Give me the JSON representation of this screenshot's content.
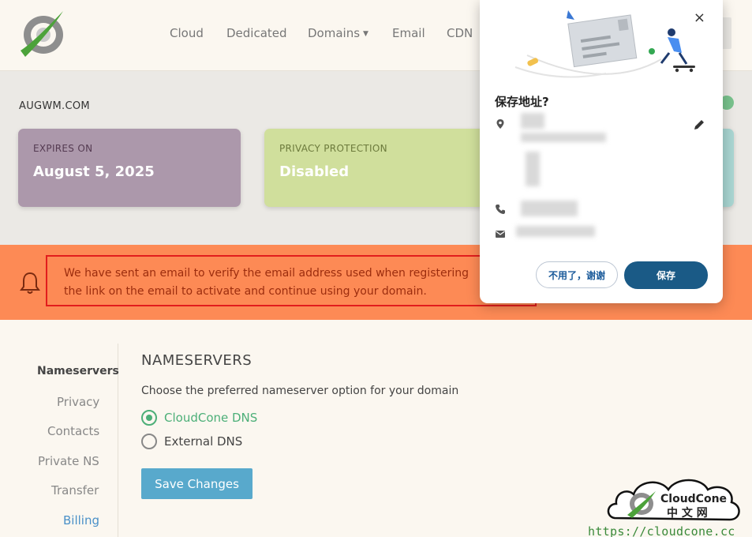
{
  "nav": {
    "items": [
      "Cloud",
      "Dedicated",
      "Domains",
      "Email",
      "CDN"
    ]
  },
  "domain": {
    "name": "AUGWM.COM",
    "cards": [
      {
        "key": "EXPIRES ON",
        "value": "August 5, 2025"
      },
      {
        "key": "PRIVACY PROTECTION",
        "value": "Disabled"
      }
    ]
  },
  "alert": {
    "line1": "We have sent an email to verify the email address used when registering",
    "line2": "the link on the email to activate and continue using your domain."
  },
  "sidebar": {
    "items": [
      "Nameservers",
      "Privacy",
      "Contacts",
      "Private NS",
      "Transfer",
      "Billing"
    ]
  },
  "nameservers": {
    "title": "NAMESERVERS",
    "description": "Choose the preferred nameserver option for your domain",
    "options": [
      "CloudCone DNS",
      "External DNS"
    ],
    "selected": "CloudCone DNS",
    "save_label": "Save Changes"
  },
  "popup": {
    "title": "保存地址?",
    "close": "×",
    "decline_label": "不用了，谢谢",
    "save_label": "保存"
  },
  "watermark": {
    "brand": "CloudCone",
    "sub": "中文网",
    "url": "https://cloudcone.cc"
  },
  "colors": {
    "alert": "#fd8a55",
    "card_expires": "#ac98ab",
    "card_privacy": "#d0df9c",
    "accent_green": "#4caf78",
    "button_blue": "#58a9cc",
    "popup_primary": "#1a5a86"
  }
}
